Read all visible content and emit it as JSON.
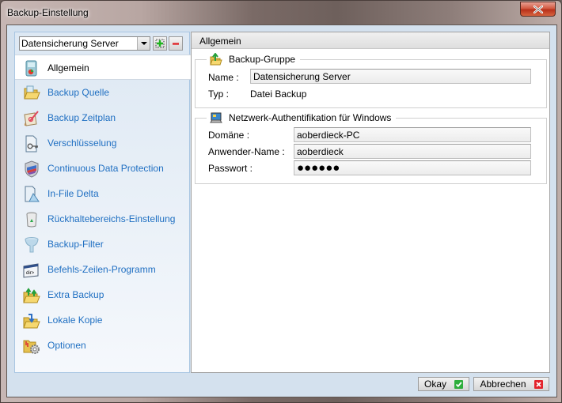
{
  "window": {
    "title": "Backup-Einstellung",
    "close_icon": "close-x-icon"
  },
  "sidebar": {
    "group_select": {
      "value": "Datensicherung Server"
    },
    "add_button_icon": "plus-icon",
    "remove_button_icon": "minus-icon",
    "items": [
      {
        "label": "Allgemein",
        "icon": "general-document-icon",
        "active": true
      },
      {
        "label": "Backup Quelle",
        "icon": "folder-open-icon"
      },
      {
        "label": "Backup Zeitplan",
        "icon": "calendar-pencil-icon"
      },
      {
        "label": "Verschlüsselung",
        "icon": "key-document-icon"
      },
      {
        "label": "Continuous Data Protection",
        "icon": "shield-icon"
      },
      {
        "label": "In-File Delta",
        "icon": "delta-document-icon"
      },
      {
        "label": "Rückhaltebereichs-Einstellung",
        "icon": "recycle-bin-icon"
      },
      {
        "label": "Backup-Filter",
        "icon": "funnel-filter-icon"
      },
      {
        "label": "Befehls-Zeilen-Programm",
        "icon": "command-line-icon"
      },
      {
        "label": "Extra Backup",
        "icon": "folder-upload-icon"
      },
      {
        "label": "Lokale Kopie",
        "icon": "folder-copy-icon"
      },
      {
        "label": "Optionen",
        "icon": "folder-gear-icon"
      }
    ]
  },
  "content": {
    "header": "Allgemein",
    "backup_group": {
      "legend": "Backup-Gruppe",
      "name_label": "Name :",
      "name_value": "Datensicherung Server",
      "type_label": "Typ :",
      "type_value": "Datei Backup"
    },
    "network_auth": {
      "legend": "Netzwerk-Authentifikation für Windows",
      "domain_label": "Domäne :",
      "domain_value": "aoberdieck-PC",
      "user_label": "Anwender-Name :",
      "user_value": "aoberdieck",
      "password_label": "Passwort :",
      "password_value": "●●●●●●"
    }
  },
  "footer": {
    "ok_label": "Okay",
    "cancel_label": "Abbrechen"
  }
}
